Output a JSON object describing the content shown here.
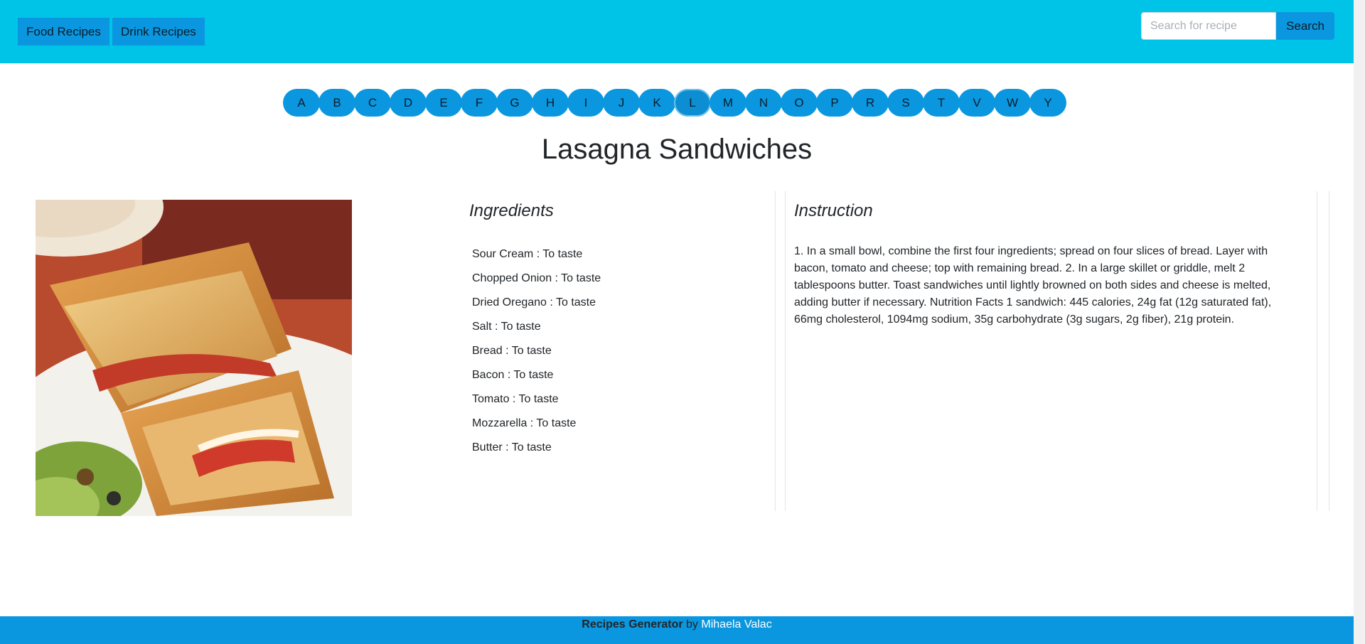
{
  "nav": {
    "food_label": "Food Recipes",
    "drink_label": "Drink Recipes"
  },
  "search": {
    "placeholder": "Search for recipe",
    "value": "",
    "button_label": "Search"
  },
  "letters": [
    "A",
    "B",
    "C",
    "D",
    "E",
    "F",
    "G",
    "H",
    "I",
    "J",
    "K",
    "L",
    "M",
    "N",
    "O",
    "P",
    "R",
    "S",
    "T",
    "V",
    "W",
    "Y"
  ],
  "active_letter": "L",
  "recipe": {
    "title": "Lasagna Sandwiches",
    "ingredients_heading": "Ingredients",
    "instruction_heading": "Instruction",
    "ingredients": [
      "Sour Cream : To taste",
      "Chopped Onion : To taste",
      "Dried Oregano : To taste",
      "Salt : To taste",
      "Bread : To taste",
      "Bacon : To taste",
      "Tomato : To taste",
      "Mozzarella : To taste",
      "Butter : To taste"
    ],
    "instructions": "1. In a small bowl, combine the first four ingredients; spread on four slices of bread. Layer with bacon, tomato and cheese; top with remaining bread. 2. In a large skillet or griddle, melt 2 tablespoons butter. Toast sandwiches until lightly browned on both sides and cheese is melted, adding butter if necessary. Nutrition Facts 1 sandwich: 445 calories, 24g fat (12g saturated fat), 66mg cholesterol, 1094mg sodium, 35g carbohydrate (3g sugars, 2g fiber), 21g protein."
  },
  "footer": {
    "brand": "Recipes Generator",
    "by": "by",
    "author": "Mihaela Valac"
  },
  "colors": {
    "navbar": "#00c3e8",
    "accent": "#0a97e0"
  }
}
